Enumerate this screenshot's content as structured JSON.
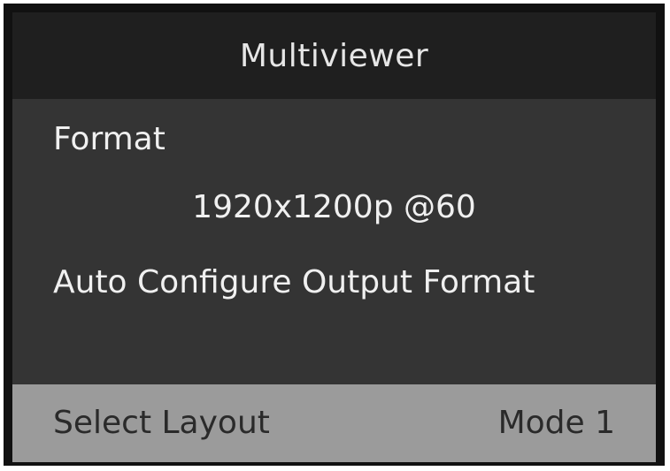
{
  "header": {
    "title": "Multiviewer"
  },
  "menu": {
    "format_label": "Format",
    "format_value": "1920x1200p @60",
    "auto_configure_label": "Auto Configure Output Format"
  },
  "footer": {
    "label": "Select Layout",
    "value": "Mode 1"
  },
  "colors": {
    "header_bg": "#1f1f1f",
    "body_bg": "#343434",
    "footer_bg": "#9b9b9b",
    "text_light": "#f0f0f0",
    "text_dark": "#2a2a2a"
  }
}
